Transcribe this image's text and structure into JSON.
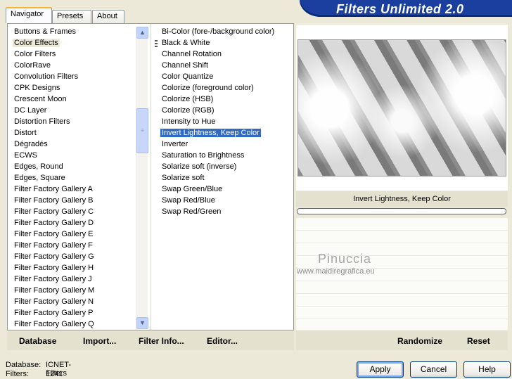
{
  "tabs": [
    {
      "label": "Navigator",
      "active": true
    },
    {
      "label": "Presets",
      "active": false
    },
    {
      "label": "About",
      "active": false
    }
  ],
  "banner_title": "Filters Unlimited 2.0",
  "categories": [
    "Buttons & Frames",
    "Color Effects",
    "Color Filters",
    "ColorRave",
    "Convolution Filters",
    "CPK Designs",
    "Crescent Moon",
    "DC Layer",
    "Distortion Filters",
    "Distort",
    "Dégradés",
    "ECWS",
    "Edges, Round",
    "Edges, Square",
    "Filter Factory Gallery A",
    "Filter Factory Gallery B",
    "Filter Factory Gallery C",
    "Filter Factory Gallery D",
    "Filter Factory Gallery E",
    "Filter Factory Gallery F",
    "Filter Factory Gallery G",
    "Filter Factory Gallery H",
    "Filter Factory Gallery J",
    "Filter Factory Gallery M",
    "Filter Factory Gallery N",
    "Filter Factory Gallery P",
    "Filter Factory Gallery Q"
  ],
  "selected_category": "Color Effects",
  "filters": [
    "Bi-Color (fore-/background color)",
    "Black & White",
    "Channel Rotation",
    "Channel Shift",
    "Color Quantize",
    "Colorize (foreground color)",
    "Colorize (HSB)",
    "Colorize (RGB)",
    "Intensity to Hue",
    "Invert Lightness, Keep Color",
    "Inverter",
    "Saturation to Brightness",
    "Solarize soft (inverse)",
    "Solarize soft",
    "Swap Green/Blue",
    "Swap Red/Blue",
    "Swap Red/Green"
  ],
  "selected_filter": "Invert Lightness, Keep Color",
  "preview_label": "Invert Lightness, Keep Color",
  "progress": 0,
  "watermark": {
    "name": "Pinuccia",
    "url": "www.maidiregrafica.eu"
  },
  "bottom_left": {
    "database": "Database",
    "import": "Import...",
    "filter_info": "Filter Info...",
    "editor": "Editor..."
  },
  "bottom_right": {
    "randomize": "Randomize",
    "reset": "Reset"
  },
  "status": {
    "database_label": "Database:",
    "database_value": "ICNET-Filters",
    "filters_label": "Filters:",
    "filters_value": "1241"
  },
  "buttons": {
    "apply": "Apply",
    "cancel": "Cancel",
    "help": "Help"
  },
  "scroll_up_icon": "chevron-up-icon",
  "scroll_down_icon": "chevron-down-icon"
}
